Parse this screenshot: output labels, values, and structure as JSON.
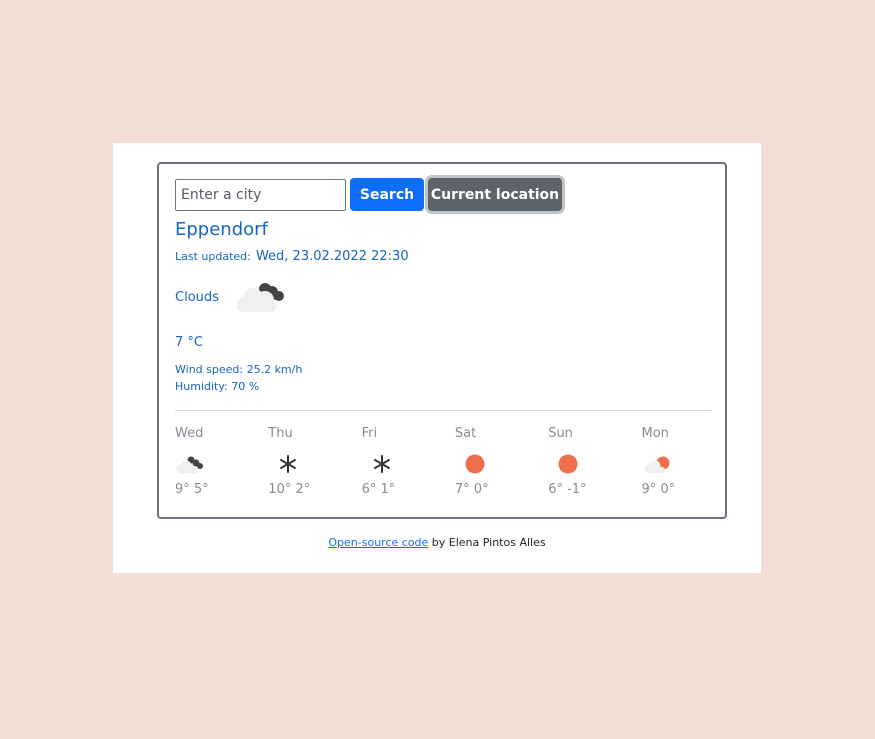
{
  "search": {
    "placeholder": "Enter a city",
    "value": "",
    "search_label": "Search",
    "location_label": "Current location"
  },
  "current": {
    "city": "Eppendorf",
    "last_updated_label": "Last updated:",
    "last_updated_value": "Wed, 23.02.2022 22:30",
    "description": "Clouds",
    "icon": "broken-clouds-icon",
    "temperature": "7 °C",
    "wind_speed": "Wind speed: 25.2 km/h",
    "humidity": "Humidity: 70 %"
  },
  "forecast": [
    {
      "day": "Wed",
      "icon": "broken-clouds-icon",
      "temps": "9° 5°"
    },
    {
      "day": "Thu",
      "icon": "snow-icon",
      "temps": "10° 2°"
    },
    {
      "day": "Fri",
      "icon": "snow-icon",
      "temps": "6° 1°"
    },
    {
      "day": "Sat",
      "icon": "sun-icon",
      "temps": "7° 0°"
    },
    {
      "day": "Sun",
      "icon": "sun-icon",
      "temps": "6° -1°"
    },
    {
      "day": "Mon",
      "icon": "partly-cloudy-icon",
      "temps": "9° 0°"
    }
  ],
  "footer": {
    "link_text": "Open-source code",
    "by_text": " by Elena Pintos Alles"
  },
  "colors": {
    "accent_blue": "#1466c0",
    "button_primary": "#0d6efd",
    "button_secondary": "#5c636a",
    "sun": "#ef6f4c",
    "page_background": "#f4dfd8"
  }
}
